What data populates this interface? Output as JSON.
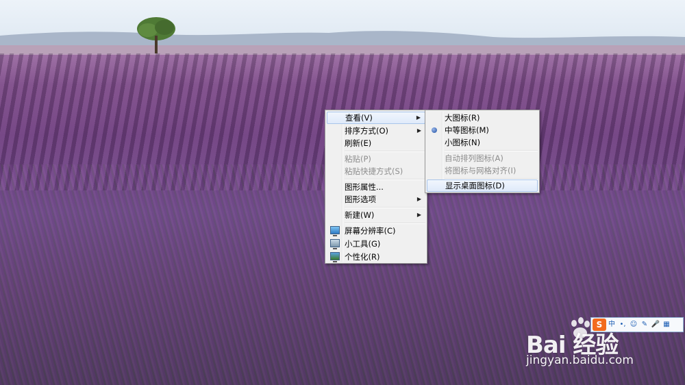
{
  "context_menu": {
    "items": [
      {
        "label": "查看(V)",
        "submenu": true,
        "disabled": false,
        "highlighted": true
      },
      {
        "label": "排序方式(O)",
        "submenu": true,
        "disabled": false
      },
      {
        "label": "刷新(E)",
        "submenu": false,
        "disabled": false
      },
      {
        "label": "粘贴(P)",
        "submenu": false,
        "disabled": true
      },
      {
        "label": "粘贴快捷方式(S)",
        "submenu": false,
        "disabled": true
      },
      {
        "label": "图形属性...",
        "submenu": false,
        "disabled": false
      },
      {
        "label": "图形选项",
        "submenu": true,
        "disabled": false
      },
      {
        "label": "新建(W)",
        "submenu": true,
        "disabled": false
      },
      {
        "label": "屏幕分辨率(C)",
        "icon": "display-icon"
      },
      {
        "label": "小工具(G)",
        "icon": "gadgets-icon"
      },
      {
        "label": "个性化(R)",
        "icon": "personalize-icon"
      }
    ]
  },
  "view_submenu": {
    "items": [
      {
        "label": "大图标(R)",
        "disabled": false
      },
      {
        "label": "中等图标(M)",
        "disabled": false,
        "selected": true
      },
      {
        "label": "小图标(N)",
        "disabled": false
      },
      {
        "label": "自动排列图标(A)",
        "disabled": true
      },
      {
        "label": "将图标与网格对齐(I)",
        "disabled": true
      },
      {
        "label": "显示桌面图标(D)",
        "disabled": false,
        "highlighted": true
      }
    ]
  },
  "ime_toolbar": {
    "logo": "S",
    "mode": "中",
    "punct": "•,",
    "emoji": "☺",
    "tool": "✎",
    "mic": "🎤",
    "grid": "▦"
  },
  "watermark": {
    "brand": "Bai  经验",
    "url": "jingyan.baidu.com"
  },
  "colors": {
    "menu_bg": "#f0f0f0",
    "menu_hover": "#dfeafa",
    "disabled_text": "#8d8d8d",
    "ime_accent": "#f26b1d"
  }
}
